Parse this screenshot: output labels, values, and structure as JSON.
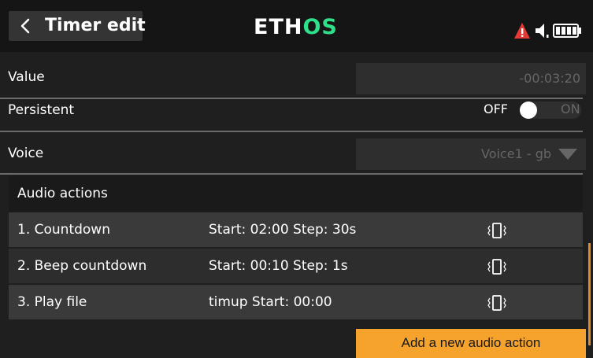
{
  "header": {
    "title": "Timer edit",
    "logo": {
      "main": "ETH",
      "accent": "OS"
    }
  },
  "fields": {
    "value": {
      "label": "Value",
      "value": "-00:03:20"
    },
    "persistent": {
      "label": "Persistent",
      "off_label": "OFF",
      "on_label": "ON",
      "state": "off"
    },
    "voice": {
      "label": "Voice",
      "value": "Voice1 - gb"
    }
  },
  "audio_actions": {
    "header": "Audio actions",
    "items": [
      {
        "name": "1. Countdown",
        "detail": "Start: 02:00 Step: 30s"
      },
      {
        "name": "2. Beep countdown",
        "detail": "Start: 00:10 Step: 1s"
      },
      {
        "name": "3. Play file",
        "detail": "timup Start: 00:00"
      }
    ],
    "add_button": "Add a new audio action"
  },
  "colors": {
    "accent_orange": "#f5a32c",
    "logo_green": "#2fe08a",
    "warning_red": "#e53935",
    "row_odd": "#3a3a3a",
    "row_even": "#2d2d2d"
  },
  "icons": [
    "back-arrow-icon",
    "warning-icon",
    "speaker-icon",
    "battery-icon",
    "vibrate-icon",
    "dropdown-arrow-icon"
  ]
}
